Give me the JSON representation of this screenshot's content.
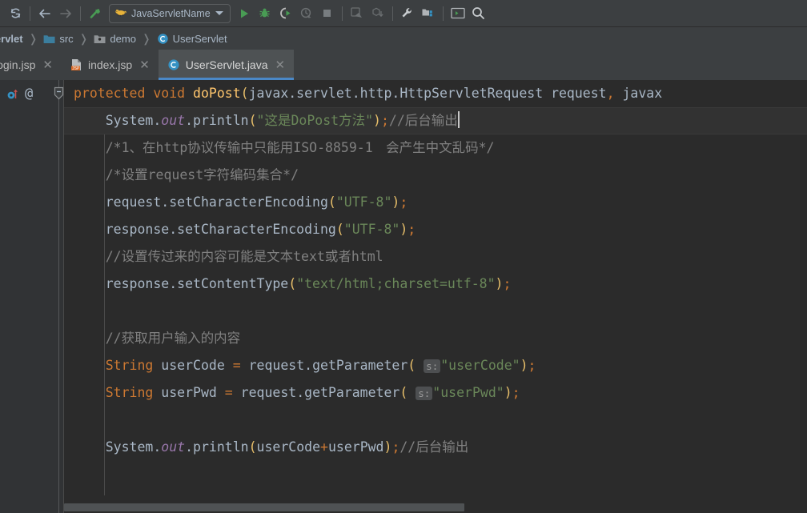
{
  "toolbar": {
    "buttons": [
      {
        "name": "sync-refresh-icon",
        "glyph": "⟳"
      },
      {
        "name": "back-arrow-icon",
        "glyph": "←"
      },
      {
        "name": "forward-arrow-icon",
        "glyph": "→"
      },
      {
        "name": "build-hammer-icon",
        "glyph": "build"
      }
    ],
    "run_config": {
      "icon": "tomcat-cat-icon",
      "label": "JavaServletName",
      "dropdown_icon": "chevron-down-icon"
    },
    "actions": [
      {
        "name": "run-icon",
        "glyph": "run"
      },
      {
        "name": "debug-icon",
        "glyph": "debug"
      },
      {
        "name": "run-coverage-icon",
        "glyph": "coverage"
      },
      {
        "name": "profile-icon",
        "glyph": "profile"
      },
      {
        "name": "stop-icon",
        "glyph": "stop"
      },
      {
        "name": "update-application-icon",
        "glyph": "update"
      },
      {
        "name": "deploy-artifact-icon",
        "glyph": "deploy"
      },
      {
        "name": "settings-wrench-icon",
        "glyph": "wrench"
      },
      {
        "name": "project-structure-icon",
        "glyph": "structure"
      },
      {
        "name": "terminal-icon",
        "glyph": "terminal"
      },
      {
        "name": "search-everywhere-icon",
        "glyph": "search"
      }
    ]
  },
  "breadcrumb": {
    "items": [
      {
        "label": "aServlet",
        "icon": "project-root-icon",
        "root": true
      },
      {
        "label": "src",
        "icon": "source-folder-icon"
      },
      {
        "label": "demo",
        "icon": "package-folder-icon"
      },
      {
        "label": "UserServlet",
        "icon": "java-class-icon"
      }
    ],
    "separator": "❭"
  },
  "tabs": {
    "close_glyph": "✕",
    "items": [
      {
        "label": "login.jsp",
        "icon": "jsp-file-icon",
        "active": false,
        "icon_visible": false
      },
      {
        "label": "index.jsp",
        "icon": "jsp-file-icon",
        "active": false,
        "icon_visible": true
      },
      {
        "label": "UserServlet.java",
        "icon": "java-class-icon",
        "active": true,
        "icon_visible": true
      }
    ]
  },
  "gutter": {
    "markers": [
      {
        "name": "override-method-icon",
        "tooltip": "Overrides method"
      },
      {
        "name": "annotation-at-icon",
        "glyph": "@"
      }
    ],
    "fold_widget": {
      "name": "collapse-fold-icon",
      "glyph": "−"
    }
  },
  "editor": {
    "language": "java",
    "colors": {
      "background": "#2b2b2b",
      "keyword": "#cc7832",
      "method": "#ffc66d",
      "string": "#6a8759",
      "comment": "#808080",
      "field": "#9876aa",
      "identifier": "#a9b7c6",
      "bracket": "#e8bf6a",
      "current_line": "#323232"
    },
    "inlay_hints": {
      "parameter_name": "s:"
    },
    "code_lines": [
      "protected void doPost(javax.servlet.http.HttpServletRequest request, javax",
      "    System.out.println(\"这是DoPost方法\");//后台输出",
      "    /*1、在http协议传输中只能用ISO-8859-1  会产生中文乱码*/",
      "    /*设置request字符编码集合*/",
      "    request.setCharacterEncoding(\"UTF-8\");",
      "    response.setCharacterEncoding(\"UTF-8\");",
      "    //设置传过来的内容可能是文本text或者html",
      "    response.setContentType(\"text/html;charset=utf-8\");",
      "",
      "    //获取用户输入的内容",
      "    String userCode = request.getParameter( s: \"userCode\");",
      "    String userPwd = request.getParameter( s: \"userPwd\");",
      "",
      "    System.out.println(userCode+userPwd);//后台输出"
    ],
    "tokens": {
      "l1": {
        "kw1": "protected",
        "kw2": "void",
        "method": "doPost",
        "args": "javax.servlet.http.HttpServletRequest request, javax"
      },
      "l2": {
        "sys": "System",
        "field": "out",
        "call": "println",
        "string": "\"这是DoPost方法\"",
        "comment": "//后台输出"
      },
      "l3": {
        "comment": "/*1、在http协议传输中只能用ISO-8859-1　会产生中文乱码*/"
      },
      "l4": {
        "comment": "/*设置request字符编码集合*/"
      },
      "l5": {
        "obj": "request",
        "call": "setCharacterEncoding",
        "string": "\"UTF-8\""
      },
      "l6": {
        "obj": "response",
        "call": "setCharacterEncoding",
        "string": "\"UTF-8\""
      },
      "l7": {
        "comment": "//设置传过来的内容可能是文本text或者html"
      },
      "l8": {
        "obj": "response",
        "call": "setContentType",
        "string": "\"text/html;charset=utf-8\""
      },
      "l10": {
        "comment": "//获取用户输入的内容"
      },
      "l11": {
        "type": "String",
        "var": "userCode",
        "obj": "request",
        "call": "getParameter",
        "hint": "s:",
        "string": "\"userCode\""
      },
      "l12": {
        "type": "String",
        "var": "userPwd",
        "obj": "request",
        "call": "getParameter",
        "hint": "s:",
        "string": "\"userPwd\""
      },
      "l14": {
        "sys": "System",
        "field": "out",
        "call": "println",
        "arg": "userCode+userPwd",
        "comment": "//后台输出"
      }
    }
  },
  "scrollbar": {
    "orientation": "horizontal",
    "name": "editor-horizontal-scrollbar"
  }
}
